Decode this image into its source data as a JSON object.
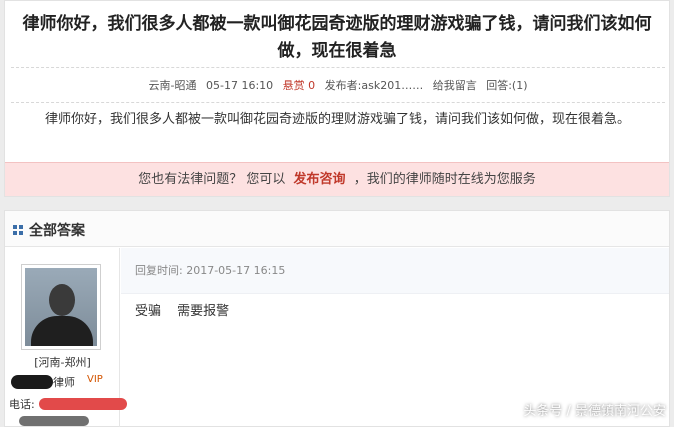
{
  "question": {
    "title": "律师你好，我们很多人都被一款叫御花园奇迹版的理财游戏骗了钱，请问我们该如何做，现在很着急",
    "meta": {
      "location": "云南-昭通",
      "time": "05-17 16:10",
      "bounty": "悬赏 0",
      "author": "发布者:ask201……",
      "leave_message": "给我留言",
      "answers": "回答:(1)"
    },
    "body": "律师你好，我们很多人都被一款叫御花园奇迹版的理财游戏骗了钱，请问我们该如何做，现在很着急。"
  },
  "consult_bar": {
    "prefix": "您也有法律问题？ 您可以",
    "link": "发布咨询",
    "suffix": "，我们的律师随时在线为您服务"
  },
  "answers_section": {
    "title": "全部答案",
    "lawyer": {
      "location": "[河南-郑州]",
      "title": "律师",
      "vip": "VIP",
      "phone_label": "电话:"
    },
    "answer": {
      "reply_time": "回复时间: 2017-05-17 16:15",
      "text_1": "受骗",
      "text_2": "需要报警"
    }
  },
  "watermark": "头条号 / 景德镇南河公安",
  "colors": {
    "accent_red": "#c0392b",
    "consult_bg": "#fde1e1",
    "icon_blue": "#3b6ea8"
  }
}
